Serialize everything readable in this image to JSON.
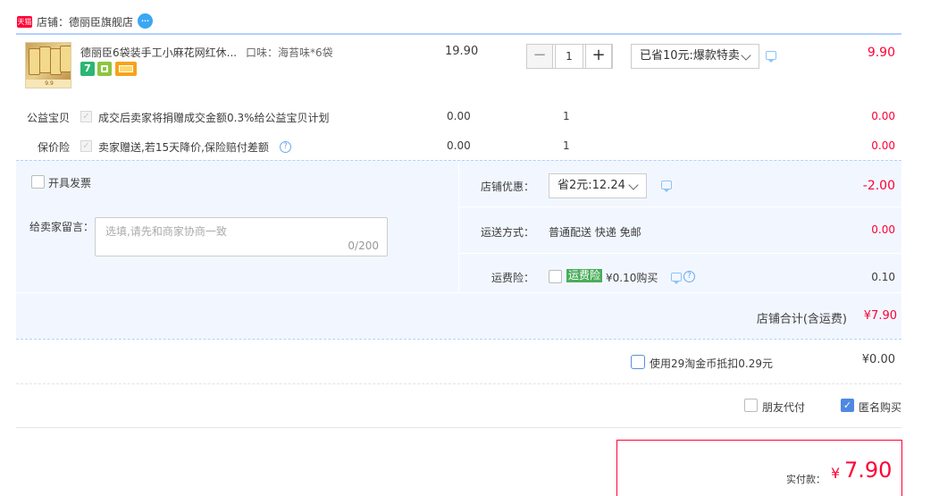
{
  "shop": {
    "badge": "天猫",
    "label": "店铺：",
    "name": "德丽臣旗舰店",
    "ww_icon": "wangwang-chat-icon"
  },
  "item": {
    "title": "德丽臣6袋装手工小麻花网红休...",
    "sku": "口味：海苔味*6袋",
    "thumb_badge": "9.9",
    "tags": [
      {
        "icon": "seven-day-return-icon",
        "text": "7",
        "color": "#2bb673"
      },
      {
        "icon": "guarantee-icon",
        "text": "",
        "color": "#8cc63f"
      },
      {
        "icon": "credit-card-icon",
        "text": "",
        "color": "#f7a21b"
      }
    ],
    "price": "19.90",
    "quantity": "1",
    "minus": "−",
    "plus": "+",
    "promo": "已省10元:爆款特卖",
    "subtotal": "9.90"
  },
  "services": [
    {
      "name": "公益宝贝",
      "desc": "成交后卖家将捐赠成交金额0.3%给公益宝贝计划",
      "price": "0.00",
      "qty": "1",
      "subtotal": "0.00",
      "help": false
    },
    {
      "name": "保价险",
      "desc": "卖家赠送,若15天降价,保险赔付差额",
      "price": "0.00",
      "qty": "1",
      "subtotal": "0.00",
      "help": true
    }
  ],
  "invoice": {
    "label": "开具发票"
  },
  "message": {
    "label": "给卖家留言：",
    "placeholder": "选填,请先和商家协商一致",
    "count": "0/200"
  },
  "shop_discount": {
    "label": "店铺优惠：",
    "value": "省2元:12.24",
    "amount": "-2.00"
  },
  "shipping": {
    "label": "运送方式：",
    "value": "普通配送 快递 免邮",
    "amount": "0.00"
  },
  "shipping_insurance": {
    "label": "运费险：",
    "tag": "运费险",
    "price": "¥0.10购买",
    "amount": "0.10"
  },
  "shop_total": {
    "label": "店铺合计(含运费)",
    "amount": "¥7.90"
  },
  "coins": {
    "label": "使用29淘金币抵扣0.29元",
    "amount": "¥0.00"
  },
  "options": {
    "friend_pay": "朋友代付",
    "anonymous": "匿名购买",
    "anonymous_checked": true
  },
  "payment": {
    "label": "实付款：",
    "currency": "¥",
    "amount": "7.90"
  },
  "colors": {
    "accent": "#ff0036",
    "panel": "#f2f7ff",
    "link": "#4f88e3"
  }
}
